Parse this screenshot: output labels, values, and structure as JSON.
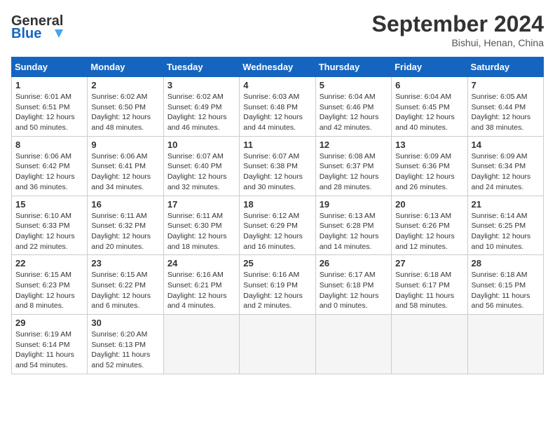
{
  "header": {
    "logo_line1": "General",
    "logo_line2": "Blue",
    "month": "September 2024",
    "location": "Bishui, Henan, China"
  },
  "days_of_week": [
    "Sunday",
    "Monday",
    "Tuesday",
    "Wednesday",
    "Thursday",
    "Friday",
    "Saturday"
  ],
  "weeks": [
    [
      {
        "day": "1",
        "info": "Sunrise: 6:01 AM\nSunset: 6:51 PM\nDaylight: 12 hours\nand 50 minutes."
      },
      {
        "day": "2",
        "info": "Sunrise: 6:02 AM\nSunset: 6:50 PM\nDaylight: 12 hours\nand 48 minutes."
      },
      {
        "day": "3",
        "info": "Sunrise: 6:02 AM\nSunset: 6:49 PM\nDaylight: 12 hours\nand 46 minutes."
      },
      {
        "day": "4",
        "info": "Sunrise: 6:03 AM\nSunset: 6:48 PM\nDaylight: 12 hours\nand 44 minutes."
      },
      {
        "day": "5",
        "info": "Sunrise: 6:04 AM\nSunset: 6:46 PM\nDaylight: 12 hours\nand 42 minutes."
      },
      {
        "day": "6",
        "info": "Sunrise: 6:04 AM\nSunset: 6:45 PM\nDaylight: 12 hours\nand 40 minutes."
      },
      {
        "day": "7",
        "info": "Sunrise: 6:05 AM\nSunset: 6:44 PM\nDaylight: 12 hours\nand 38 minutes."
      }
    ],
    [
      {
        "day": "8",
        "info": "Sunrise: 6:06 AM\nSunset: 6:42 PM\nDaylight: 12 hours\nand 36 minutes."
      },
      {
        "day": "9",
        "info": "Sunrise: 6:06 AM\nSunset: 6:41 PM\nDaylight: 12 hours\nand 34 minutes."
      },
      {
        "day": "10",
        "info": "Sunrise: 6:07 AM\nSunset: 6:40 PM\nDaylight: 12 hours\nand 32 minutes."
      },
      {
        "day": "11",
        "info": "Sunrise: 6:07 AM\nSunset: 6:38 PM\nDaylight: 12 hours\nand 30 minutes."
      },
      {
        "day": "12",
        "info": "Sunrise: 6:08 AM\nSunset: 6:37 PM\nDaylight: 12 hours\nand 28 minutes."
      },
      {
        "day": "13",
        "info": "Sunrise: 6:09 AM\nSunset: 6:36 PM\nDaylight: 12 hours\nand 26 minutes."
      },
      {
        "day": "14",
        "info": "Sunrise: 6:09 AM\nSunset: 6:34 PM\nDaylight: 12 hours\nand 24 minutes."
      }
    ],
    [
      {
        "day": "15",
        "info": "Sunrise: 6:10 AM\nSunset: 6:33 PM\nDaylight: 12 hours\nand 22 minutes."
      },
      {
        "day": "16",
        "info": "Sunrise: 6:11 AM\nSunset: 6:32 PM\nDaylight: 12 hours\nand 20 minutes."
      },
      {
        "day": "17",
        "info": "Sunrise: 6:11 AM\nSunset: 6:30 PM\nDaylight: 12 hours\nand 18 minutes."
      },
      {
        "day": "18",
        "info": "Sunrise: 6:12 AM\nSunset: 6:29 PM\nDaylight: 12 hours\nand 16 minutes."
      },
      {
        "day": "19",
        "info": "Sunrise: 6:13 AM\nSunset: 6:28 PM\nDaylight: 12 hours\nand 14 minutes."
      },
      {
        "day": "20",
        "info": "Sunrise: 6:13 AM\nSunset: 6:26 PM\nDaylight: 12 hours\nand 12 minutes."
      },
      {
        "day": "21",
        "info": "Sunrise: 6:14 AM\nSunset: 6:25 PM\nDaylight: 12 hours\nand 10 minutes."
      }
    ],
    [
      {
        "day": "22",
        "info": "Sunrise: 6:15 AM\nSunset: 6:23 PM\nDaylight: 12 hours\nand 8 minutes."
      },
      {
        "day": "23",
        "info": "Sunrise: 6:15 AM\nSunset: 6:22 PM\nDaylight: 12 hours\nand 6 minutes."
      },
      {
        "day": "24",
        "info": "Sunrise: 6:16 AM\nSunset: 6:21 PM\nDaylight: 12 hours\nand 4 minutes."
      },
      {
        "day": "25",
        "info": "Sunrise: 6:16 AM\nSunset: 6:19 PM\nDaylight: 12 hours\nand 2 minutes."
      },
      {
        "day": "26",
        "info": "Sunrise: 6:17 AM\nSunset: 6:18 PM\nDaylight: 12 hours\nand 0 minutes."
      },
      {
        "day": "27",
        "info": "Sunrise: 6:18 AM\nSunset: 6:17 PM\nDaylight: 11 hours\nand 58 minutes."
      },
      {
        "day": "28",
        "info": "Sunrise: 6:18 AM\nSunset: 6:15 PM\nDaylight: 11 hours\nand 56 minutes."
      }
    ],
    [
      {
        "day": "29",
        "info": "Sunrise: 6:19 AM\nSunset: 6:14 PM\nDaylight: 11 hours\nand 54 minutes."
      },
      {
        "day": "30",
        "info": "Sunrise: 6:20 AM\nSunset: 6:13 PM\nDaylight: 11 hours\nand 52 minutes."
      },
      {
        "day": "",
        "info": ""
      },
      {
        "day": "",
        "info": ""
      },
      {
        "day": "",
        "info": ""
      },
      {
        "day": "",
        "info": ""
      },
      {
        "day": "",
        "info": ""
      }
    ]
  ]
}
